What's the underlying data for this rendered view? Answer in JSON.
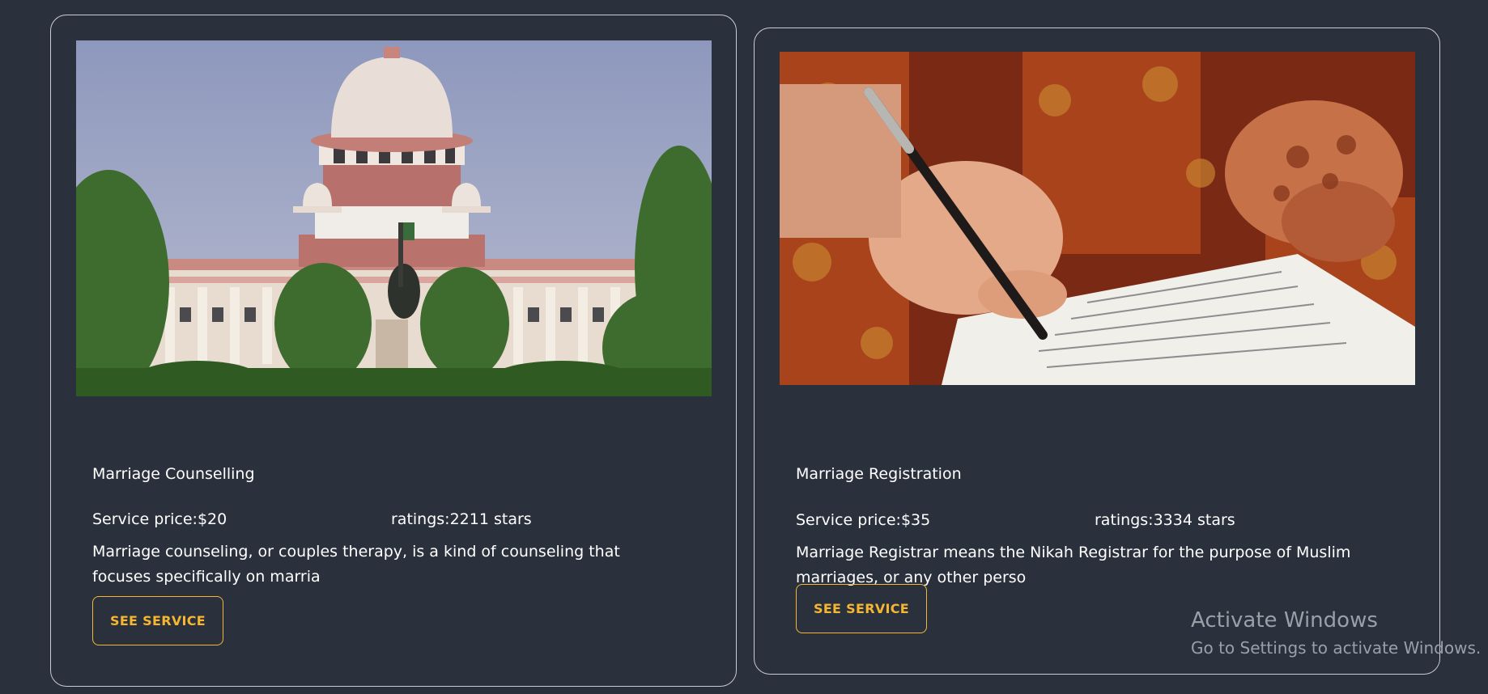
{
  "cards": [
    {
      "title": "Marriage Counselling",
      "image": "supreme-court-photo",
      "price": "Service price:$20",
      "rating": "ratings:2211 stars",
      "description": "Marriage counseling, or couples therapy, is a kind of counseling that focuses specifically on marria",
      "button": "SEE SERVICE"
    },
    {
      "title": "Marriage Registration",
      "image": "signing-document-photo",
      "price": "Service price:$35",
      "rating": "ratings:3334 stars",
      "description": "Marriage Registrar means the Nikah Registrar for the purpose of Muslim marriages, or any other perso",
      "button": "SEE SERVICE"
    }
  ],
  "watermark": {
    "title": "Activate Windows",
    "subtitle": "Go to Settings to activate Windows."
  },
  "colors": {
    "background": "#2a303c",
    "card_border": "#c8ccd4",
    "accent": "#f5b731",
    "text": "#ffffff",
    "watermark": "#9aa0a8"
  }
}
